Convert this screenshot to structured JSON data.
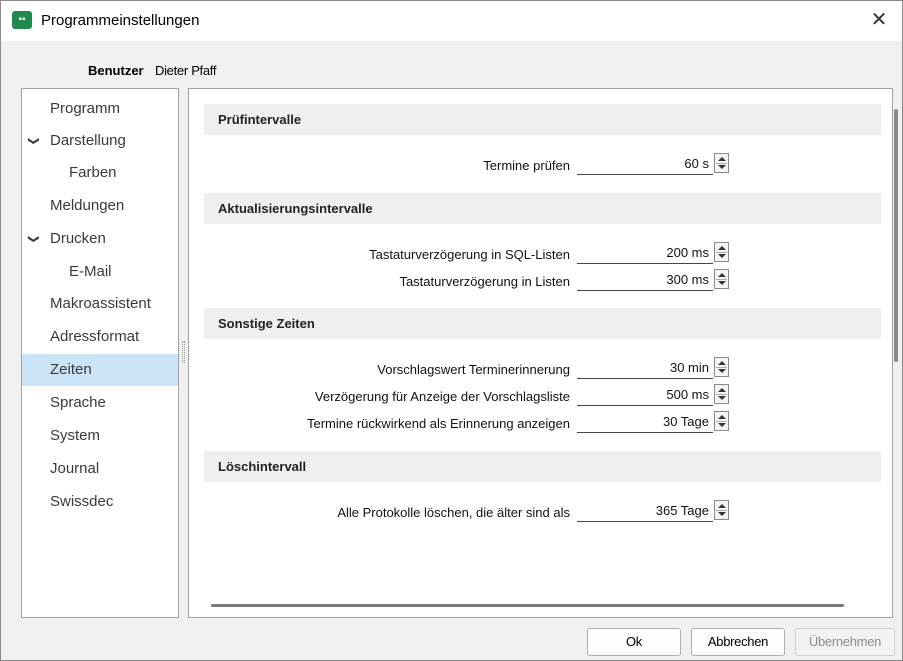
{
  "window": {
    "title": "Programmeinstellungen",
    "icon": "app-grid-icon",
    "accent": "#1f8a4c"
  },
  "user": {
    "label": "Benutzer",
    "value": "Dieter Pfaff"
  },
  "nav": {
    "items": [
      {
        "label": "Programm"
      },
      {
        "label": "Darstellung",
        "expanded": true
      },
      {
        "label": "Farben"
      },
      {
        "label": "Meldungen"
      },
      {
        "label": "Drucken",
        "expanded": true
      },
      {
        "label": "E-Mail"
      },
      {
        "label": "Makroassistent"
      },
      {
        "label": "Adressformat"
      },
      {
        "label": "Zeiten",
        "selected": true
      },
      {
        "label": "Sprache"
      },
      {
        "label": "System"
      },
      {
        "label": "Journal"
      },
      {
        "label": "Swissdec"
      }
    ]
  },
  "sections": [
    {
      "title": "Prüfintervalle",
      "rows": [
        {
          "label": "Termine prüfen",
          "value": "60 s"
        }
      ]
    },
    {
      "title": "Aktualisierungsintervalle",
      "rows": [
        {
          "label": "Tastaturverzögerung in SQL-Listen",
          "value": "200 ms"
        },
        {
          "label": "Tastaturverzögerung in Listen",
          "value": "300 ms"
        }
      ]
    },
    {
      "title": "Sonstige Zeiten",
      "rows": [
        {
          "label": "Vorschlagswert Terminerinnerung",
          "value": "30 min"
        },
        {
          "label": "Verzögerung für Anzeige der Vorschlagsliste",
          "value": "500 ms"
        },
        {
          "label": "Termine rückwirkend als Erinnerung anzeigen",
          "value": "30 Tage"
        }
      ]
    },
    {
      "title": "Löschintervall",
      "rows": [
        {
          "label": "Alle Protokolle löschen, die älter sind als",
          "value": "365 Tage"
        }
      ]
    }
  ],
  "buttons": {
    "ok": "Ok",
    "cancel": "Abbrechen",
    "apply": "Übernehmen"
  }
}
